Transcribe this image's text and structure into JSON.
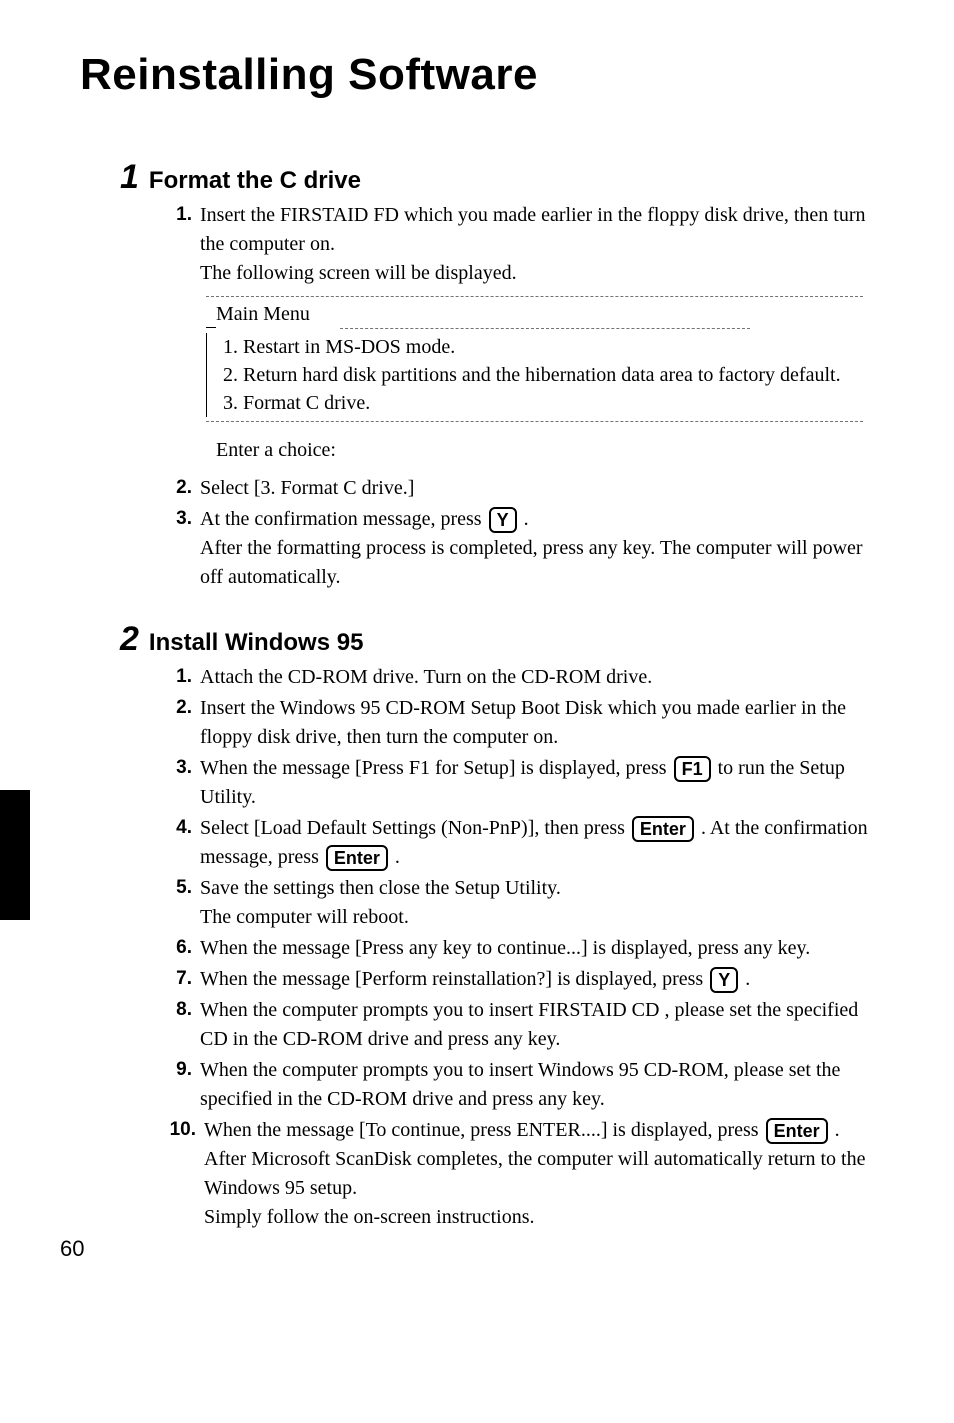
{
  "title": "Reinstalling Software",
  "page_number": "60",
  "section1": {
    "num": "1",
    "title": "Format the C drive",
    "steps": {
      "s1": {
        "num": "1.",
        "line1": "Insert the FIRSTAID FD which you made earlier in the floppy disk drive, then turn the computer on.",
        "line2": "The following screen will be displayed."
      },
      "screen": {
        "title": "Main Menu",
        "item1": "1. Restart in MS-DOS mode.",
        "item2": "2. Return hard disk partitions and the hibernation data area to factory default.",
        "item3": "3. Format C drive.",
        "prompt": "Enter a choice:"
      },
      "s2": {
        "num": "2.",
        "text": "Select [3. Format C drive.]"
      },
      "s3": {
        "num": "3.",
        "pre": "At the confirmation message, press ",
        "key": "Y",
        "post": " .",
        "after": "After the formatting process is completed, press any key. The computer will power off automatically."
      }
    }
  },
  "section2": {
    "num": "2",
    "title": "Install Windows 95",
    "steps": {
      "s1": {
        "num": "1.",
        "text": "Attach the CD-ROM drive. Turn on the CD-ROM drive."
      },
      "s2": {
        "num": "2.",
        "text": "Insert the Windows 95 CD-ROM Setup Boot Disk which you made earlier in the floppy disk drive, then turn the computer on."
      },
      "s3": {
        "num": "3.",
        "pre": "When the message [Press F1 for Setup] is displayed, press ",
        "key": "F1",
        "post": " to run the Setup Utility."
      },
      "s4": {
        "num": "4.",
        "pre": "Select [Load Default Settings (Non-PnP)], then press ",
        "key1": "Enter",
        "mid": " . At the confirmation message, press ",
        "key2": "Enter",
        "post": " ."
      },
      "s5": {
        "num": "5.",
        "line1": "Save the settings then close the Setup Utility.",
        "line2": "The computer will reboot."
      },
      "s6": {
        "num": "6.",
        "text": "When the message [Press any key to continue...] is displayed, press any key."
      },
      "s7": {
        "num": "7.",
        "pre": "When the message [Perform reinstallation?] is displayed, press ",
        "key": "Y",
        "post": " ."
      },
      "s8": {
        "num": "8.",
        "text": "When the computer prompts you to insert FIRSTAID CD , please set the specified CD in the CD-ROM drive and press any key."
      },
      "s9": {
        "num": "9.",
        "text": "When the computer prompts you to insert Windows 95 CD-ROM, please set the specified in the CD-ROM drive and press any key."
      },
      "s10": {
        "num": "10.",
        "pre": "When the message [To continue, press ENTER....] is displayed, press ",
        "key": "Enter",
        "post": " .",
        "after1": "After Microsoft ScanDisk completes, the computer will automatically return to the Windows 95 setup.",
        "after2": "Simply follow the on-screen instructions."
      }
    }
  }
}
